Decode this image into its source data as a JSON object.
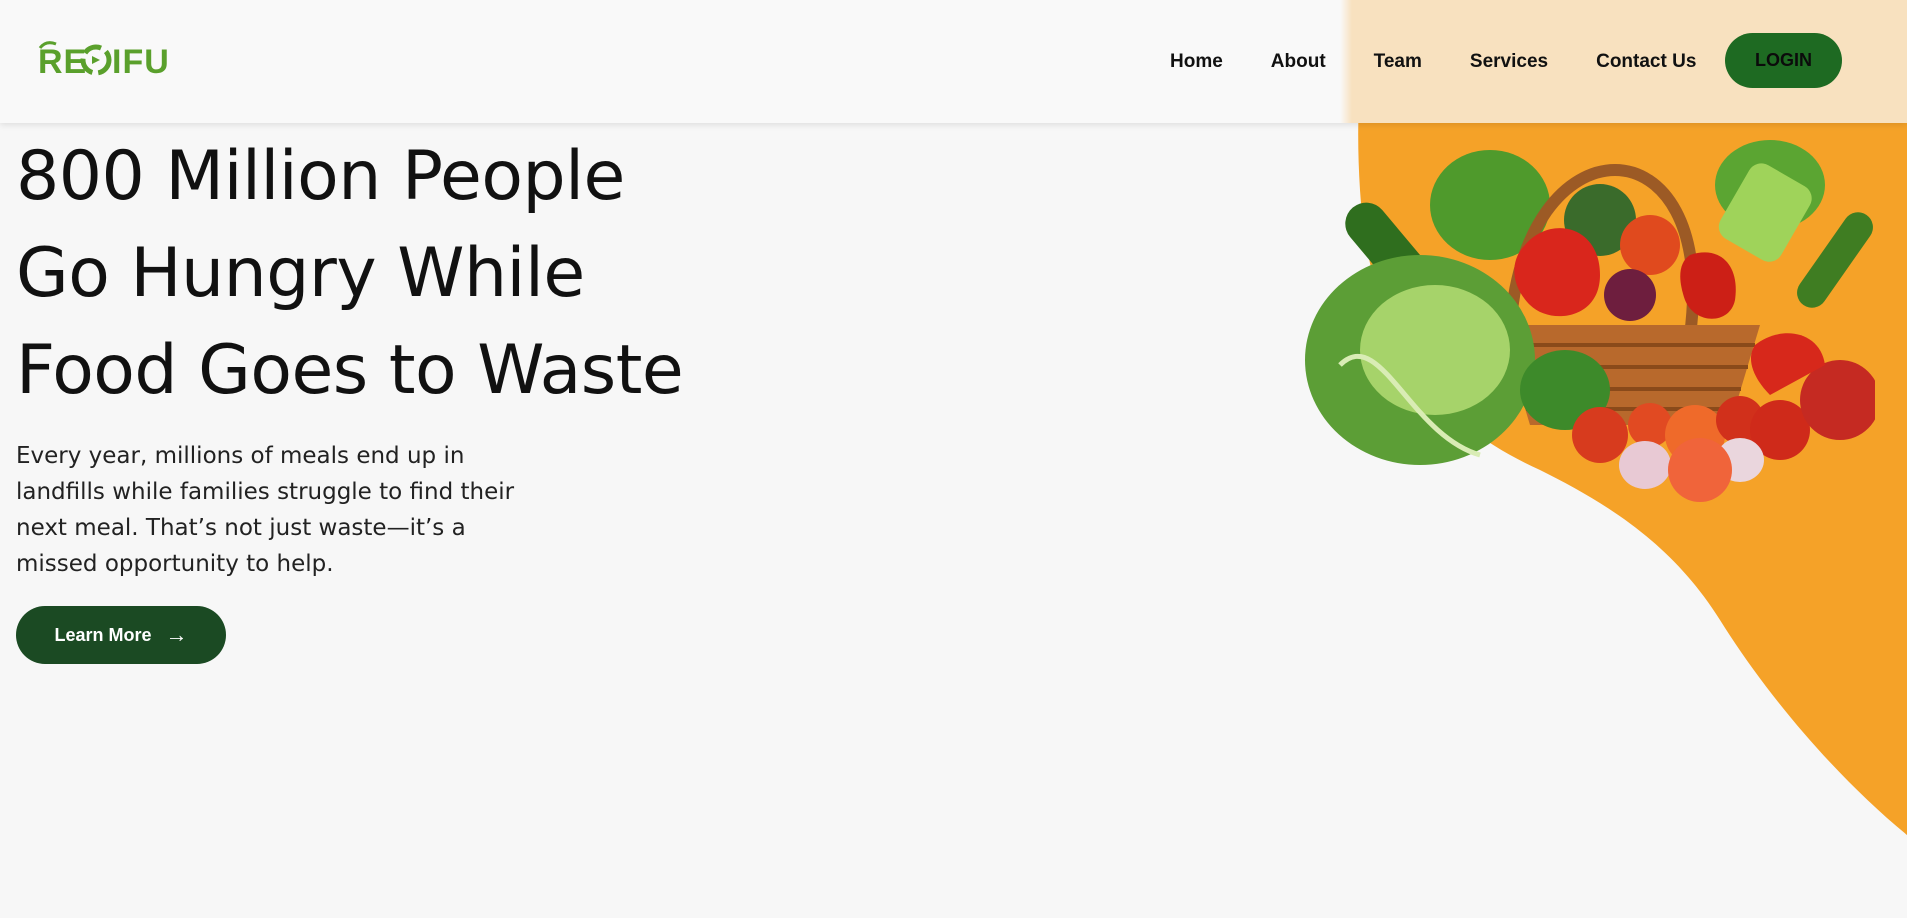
{
  "brand": {
    "logo_text": "REDIFU",
    "logo_color": "#5aa02c"
  },
  "nav": {
    "items": [
      {
        "label": "Home"
      },
      {
        "label": "About"
      },
      {
        "label": "Team"
      },
      {
        "label": "Services"
      },
      {
        "label": "Contact Us"
      }
    ],
    "login_label": "LOGIN"
  },
  "hero": {
    "title_lines": [
      "800 Million People",
      "Go Hungry While",
      "Food Goes to Waste"
    ],
    "description": "Every year, millions of meals end up in landfills while families struggle to find their next meal. That’s not just waste—it’s a missed opportunity to help.",
    "cta_label": "Learn More",
    "cta_icon": "arrow-right-icon",
    "image_subject": "basket-of-vegetables"
  },
  "colors": {
    "accent_orange": "#f5a228",
    "primary_green": "#1e6a22",
    "cta_green": "#1b4a23",
    "background": "#f7f7f7"
  }
}
